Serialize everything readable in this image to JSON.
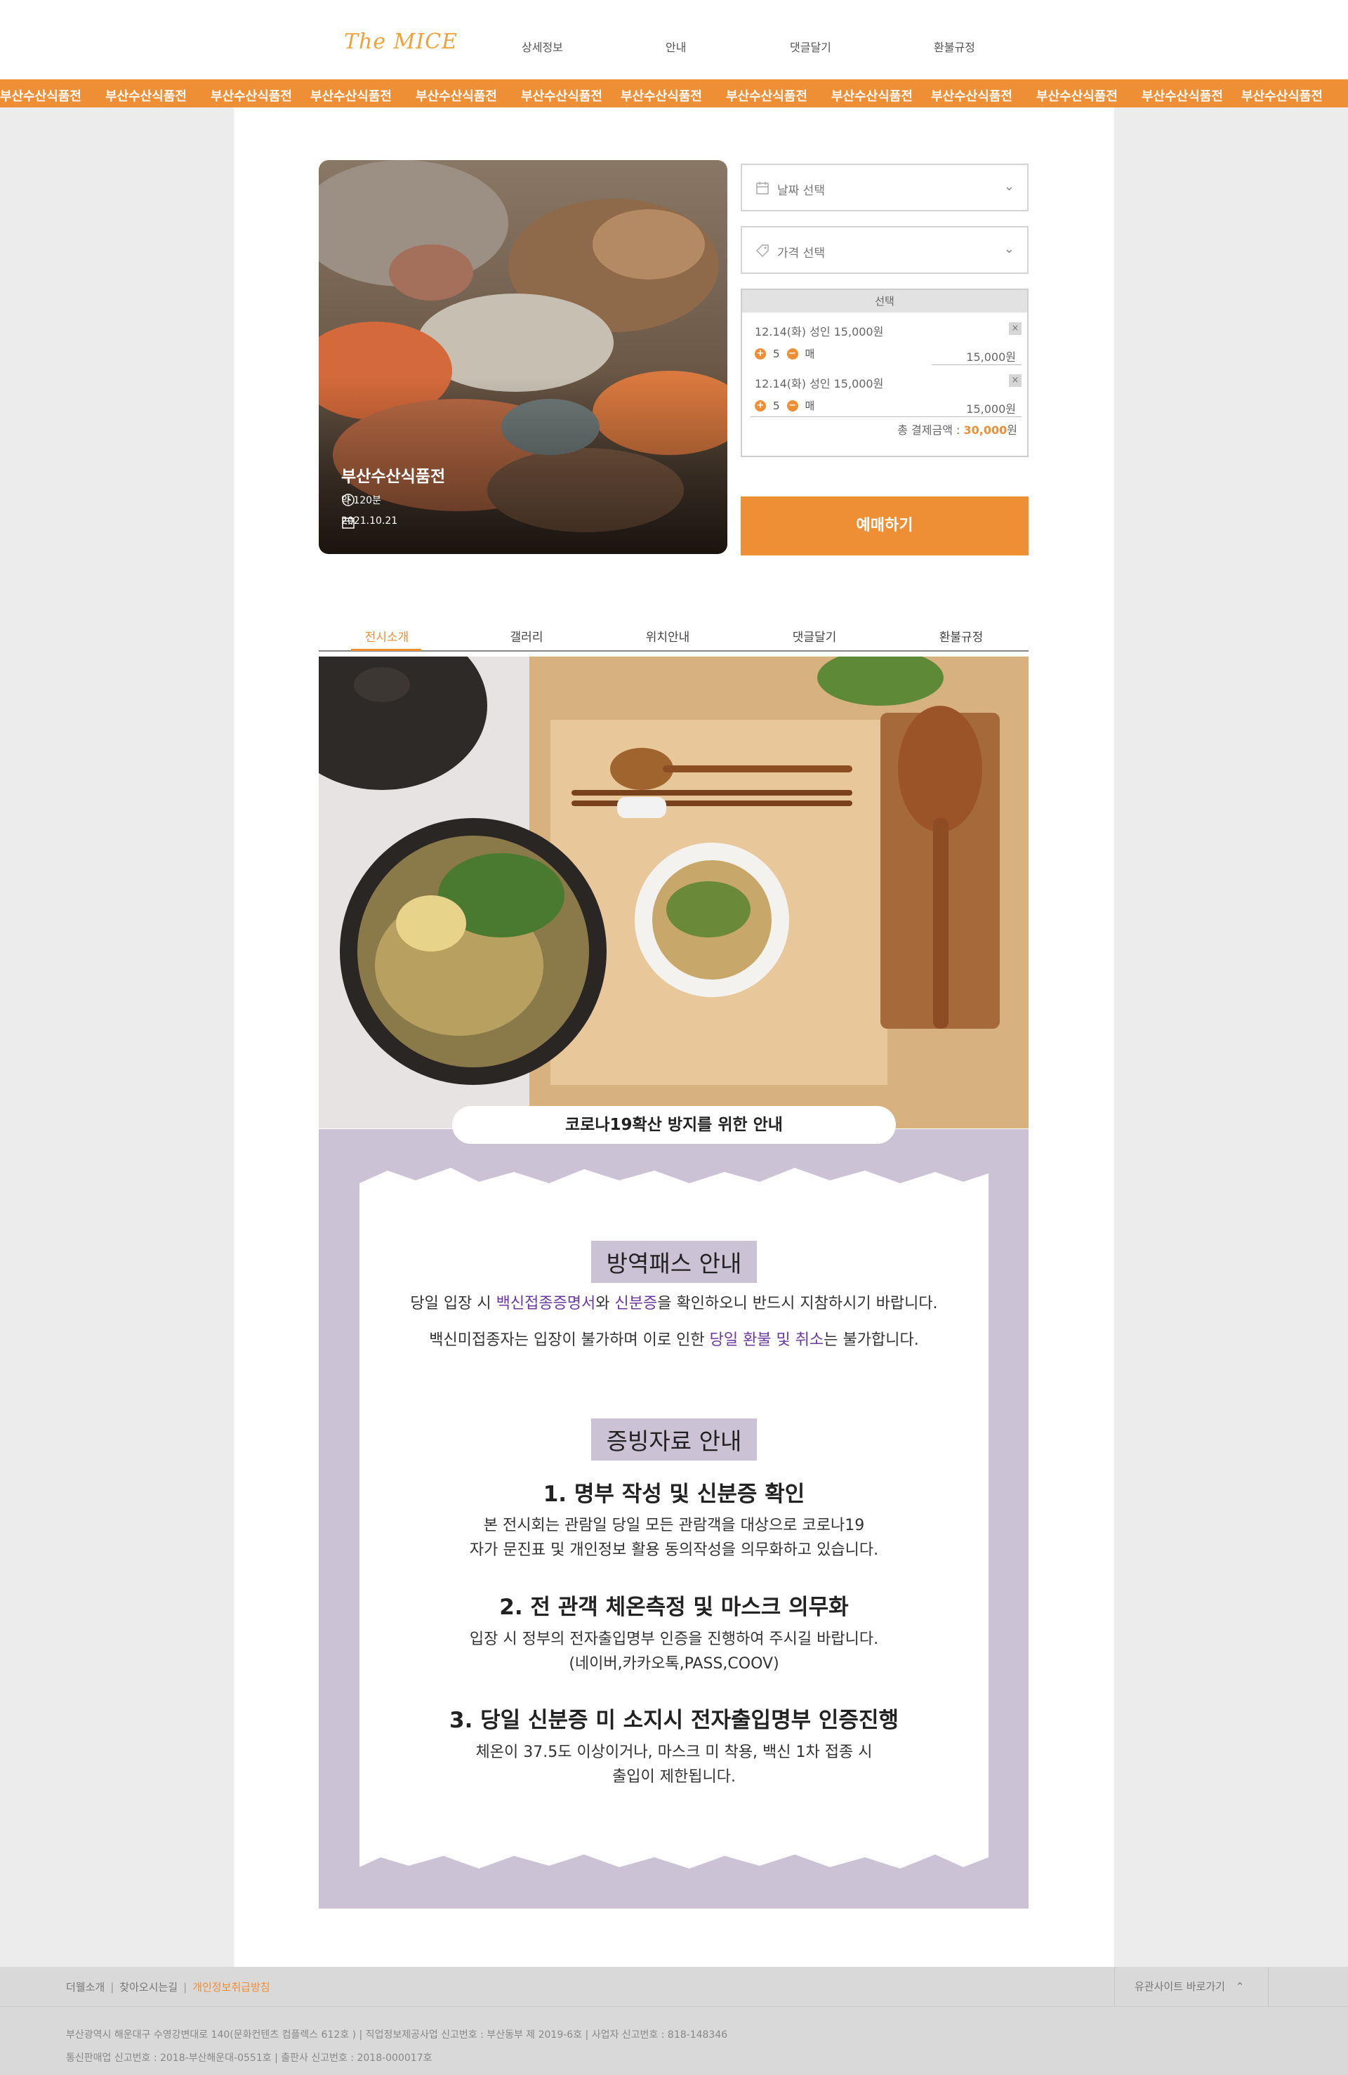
{
  "nav": {
    "logo": "The MICE",
    "links": [
      "상세정보",
      "안내",
      "댓글달기",
      "환불규정"
    ]
  },
  "strip": {
    "text": "부산수산식품전"
  },
  "poster": {
    "title": "부산수산식품전",
    "duration": "약 120분",
    "date": "2021.10.21"
  },
  "booking": {
    "date_select": "날짜 선택",
    "price_select": "가격 선택",
    "selection_header": "선택",
    "items": [
      {
        "label": "12.14(화) 성인 15,000원",
        "qty": "5",
        "unit": "매",
        "price": "15,000원"
      },
      {
        "label": "12.14(화) 성인 15,000원",
        "qty": "5",
        "unit": "매",
        "price": "15,000원"
      }
    ],
    "total_label": "총 결제금액 :",
    "total_value": "30,000",
    "total_unit": "원",
    "book_button": "예매하기",
    "accent": "#ee8e35"
  },
  "tabs": [
    "전시소개",
    "갤러리",
    "위치안내",
    "댓글달기",
    "환불규정"
  ],
  "notice": {
    "pill": "코로나19확산 방지를 위한 안내",
    "section1": {
      "badge": "방역패스 안내",
      "line1": [
        "당일 입장 시 ",
        "백신접종증명서",
        "와 ",
        "신분증",
        "을 확인하오니 반드시 지참하시기 바랍니다."
      ],
      "line2": [
        "백신미접종자는 입장이 불가하며 이로 인한 ",
        "당일 환불 및 취소",
        "는 불가합니다."
      ]
    },
    "section2": {
      "badge": "증빙자료 안내",
      "items": [
        {
          "title": "1. 명부 작성 및 신분증 확인",
          "lines": [
            "본 전시회는 관람일 당일 모든 관람객을 대상으로 코로나19",
            "자가 문진표 및 개인정보 활용 동의작성을 의무화하고 있습니다."
          ]
        },
        {
          "title": "2. 전 관객 체온측정 및 마스크 의무화",
          "lines": [
            "입장 시 정부의 전자출입명부 인증을 진행하여 주시길 바랍니다.",
            "(네이버,카카오톡,PASS,COOV)"
          ]
        },
        {
          "title": "3. 당일 신분증 미 소지시 전자출입명부 인증진행",
          "lines": [
            "체온이 37.5도 이상이거나, 마스크 미 착용, 백신 1차 접종 시",
            "출입이 제한됩니다."
          ]
        }
      ]
    },
    "highlight": "#6a3aa0",
    "lavender": "#cbc2d6"
  },
  "footer": {
    "links": [
      "더웰소개",
      "찾아오시는길",
      "개인정보취급방침"
    ],
    "family_site": "유관사이트 바로가기",
    "address": "부산광역시 해운대구 수영강변대로 140(문화컨텐츠 컴플렉스 612호 )  |  직업정보제공사업 신고번호 : 부산동부 제 2019-6호  |  사업자 신고번호 : 818-148346",
    "registry": "통신판매업 신고번호 : 2018-부산해운대-0551호  |  출판사 신고번호 : 2018-000017호"
  }
}
